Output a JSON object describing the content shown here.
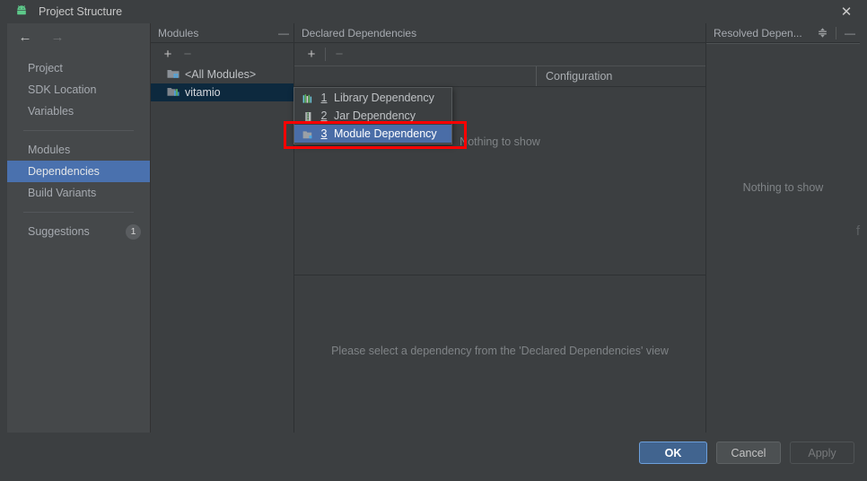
{
  "window": {
    "title": "Project Structure",
    "app_icon": "android-robot-icon",
    "close_label": "✕",
    "accent_selected": "#4a71ae",
    "accent_primary": "#41648f",
    "highlight_color": "#ff0000"
  },
  "nav": {
    "back_label": "←",
    "forward_label": "→",
    "items": [
      {
        "label": "Project",
        "selected": false
      },
      {
        "label": "SDK Location",
        "selected": false
      },
      {
        "label": "Variables",
        "selected": false
      },
      {
        "label": "Modules",
        "selected": false
      },
      {
        "label": "Dependencies",
        "selected": true
      },
      {
        "label": "Build Variants",
        "selected": false
      },
      {
        "label": "Suggestions",
        "selected": false,
        "badge": "1"
      }
    ]
  },
  "modules_panel": {
    "title": "Modules",
    "minimize_label": "—",
    "add_label": "+",
    "remove_label": "−",
    "rows": [
      {
        "label": "<All Modules>",
        "icon": "all-modules-icon",
        "selected": false
      },
      {
        "label": "vitamio",
        "icon": "module-icon",
        "selected": true
      }
    ]
  },
  "declared_panel": {
    "title": "Declared Dependencies",
    "add_label": "+",
    "remove_label": "−",
    "columns": [
      "",
      "Configuration"
    ],
    "empty_message": "Nothing to show",
    "detail_message": "Please select a dependency from the 'Declared Dependencies' view"
  },
  "resolved_panel": {
    "title": "Resolved Depen...",
    "collapse_label": "collapse-all-icon",
    "minimize_label": "—",
    "empty_message": "Nothing to show",
    "edge_glyph": "f"
  },
  "popup_menu": {
    "items": [
      {
        "mnemonic": "1",
        "label": "Library Dependency",
        "icon": "library-icon",
        "selected": false
      },
      {
        "mnemonic": "2",
        "label": "Jar Dependency",
        "icon": "jar-icon",
        "selected": false
      },
      {
        "mnemonic": "3",
        "label": "Module Dependency",
        "icon": "module-folder-icon",
        "selected": true
      }
    ]
  },
  "footer": {
    "ok_label": "OK",
    "cancel_label": "Cancel",
    "apply_label": "Apply"
  }
}
